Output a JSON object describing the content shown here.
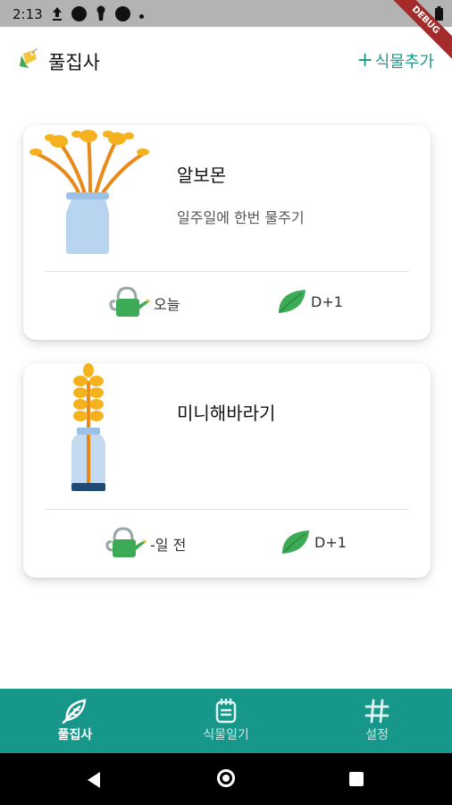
{
  "status_bar": {
    "time": "2:13",
    "debug_label": "DEBUG"
  },
  "header": {
    "title": "풀집사",
    "add_plant_label": "식물추가"
  },
  "plants": [
    {
      "name": "알보몬",
      "schedule": "일주일에 한번 물주기",
      "watering": "오늘",
      "growth": "D+1"
    },
    {
      "name": "미니해바라기",
      "schedule": "",
      "watering": "-일 전",
      "growth": "D+1"
    }
  ],
  "bottom_nav": {
    "items": [
      {
        "label": "풀집사",
        "icon": "leaf-feather-icon",
        "active": true
      },
      {
        "label": "식물일기",
        "icon": "notepad-icon",
        "active": false
      },
      {
        "label": "설정",
        "icon": "hash-icon",
        "active": false
      }
    ]
  },
  "colors": {
    "accent": "#17968a",
    "leaf": "#3daa55",
    "vase": "#b9d4ee",
    "flower": "#f5b21e"
  }
}
